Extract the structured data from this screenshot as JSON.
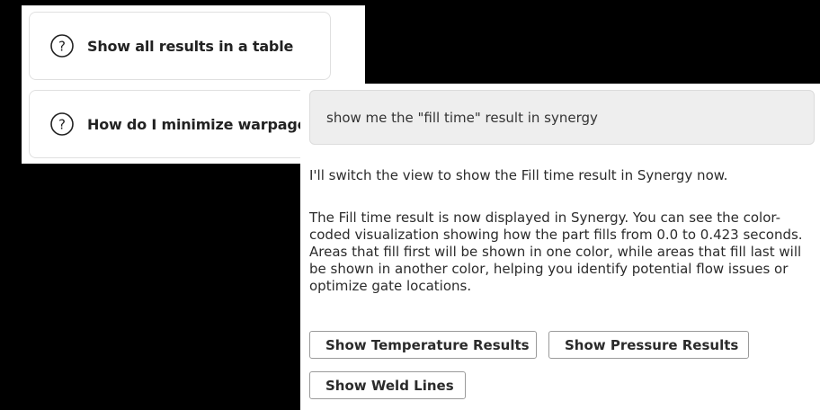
{
  "suggestions": [
    {
      "label": "Show all results in a table",
      "icon": "question-circle-icon"
    },
    {
      "label": "How do I minimize warpage?",
      "icon": "question-circle-icon"
    }
  ],
  "chat": {
    "user_message": "show me the \"fill time\" result in synergy",
    "assistant_paragraphs": [
      "I'll switch the view to show the Fill time result in Synergy now.",
      "The Fill time result is now displayed in Synergy. You can see the color-coded visualization showing how the part fills from 0.0 to 0.423 seconds. Areas that fill first will be shown in one color, while areas that fill last will be shown in another color, helping you identify potential flow issues or optimize gate locations."
    ],
    "actions": [
      "Show Temperature Results",
      "Show Pressure Results",
      "Show Weld Lines"
    ]
  },
  "colors": {
    "background": "#000000",
    "panel": "#ffffff",
    "user_bubble": "#eeeeee",
    "text": "#2b2b2b"
  }
}
